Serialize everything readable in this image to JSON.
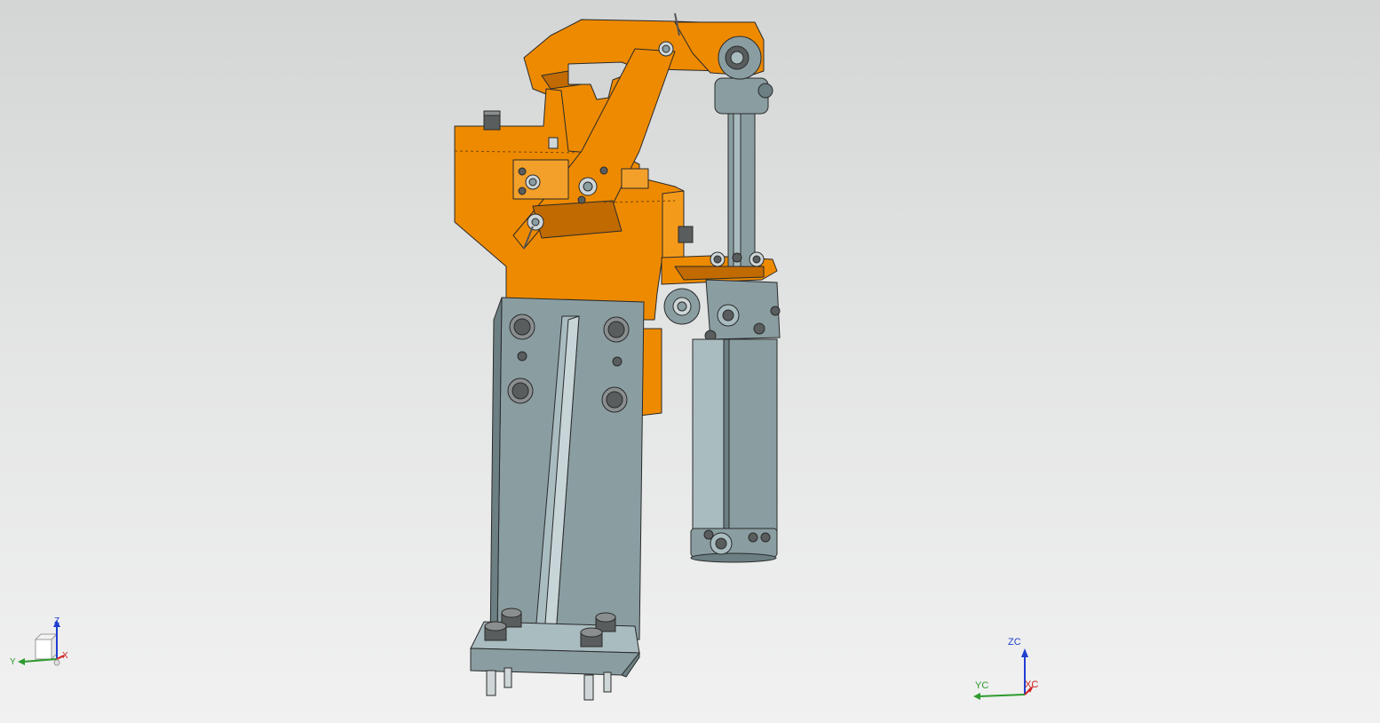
{
  "viewport": {
    "background_top": "#d4d6d6",
    "background_bottom": "#f1f1f1"
  },
  "model": {
    "colors": {
      "orange": "#ee8a00",
      "orange_dark": "#c06a00",
      "steel": "#8a9ea2",
      "steel_dark": "#6c7f83",
      "steel_light": "#a9bcc0",
      "bolt": "#595d5e",
      "outline": "#2a2a2a",
      "pin": "#cfd6d8"
    }
  },
  "view_triad": {
    "z_label": "Z",
    "y_label": "Y",
    "x_label": "X",
    "z_color": "#1f3fd0",
    "y_color": "#2e9a2e",
    "x_color": "#d02020"
  },
  "wcs_triad": {
    "z_label": "ZC",
    "y_label": "YC",
    "x_label": "XC",
    "z_color": "#1f3fd0",
    "y_color": "#2e9a2e",
    "x_color": "#d02020"
  }
}
